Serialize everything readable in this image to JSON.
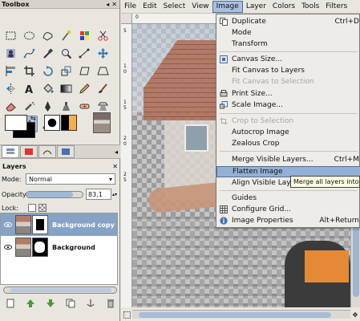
{
  "toolbox": {
    "title": "Toolbox",
    "window_controls": [
      "◂",
      "✕"
    ],
    "tools": [
      {
        "name": "rect-select-icon",
        "active": false
      },
      {
        "name": "ellipse-select-icon",
        "active": false
      },
      {
        "name": "free-select-icon",
        "active": false
      },
      {
        "name": "fuzzy-select-icon",
        "active": false
      },
      {
        "name": "color-select-icon",
        "active": false
      },
      {
        "name": "scissors-select-icon",
        "active": false
      },
      {
        "name": "foreground-select-icon",
        "active": false
      },
      {
        "name": "paths-icon",
        "active": false
      },
      {
        "name": "color-picker-icon",
        "active": false
      },
      {
        "name": "zoom-icon",
        "active": false
      },
      {
        "name": "measure-icon",
        "active": false
      },
      {
        "name": "move-icon",
        "active": false
      },
      {
        "name": "align-icon",
        "active": false
      },
      {
        "name": "crop-icon",
        "active": false
      },
      {
        "name": "rotate-icon",
        "active": false
      },
      {
        "name": "scale-icon",
        "active": false
      },
      {
        "name": "shear-icon",
        "active": false
      },
      {
        "name": "perspective-icon",
        "active": false
      },
      {
        "name": "flip-icon",
        "active": false
      },
      {
        "name": "text-icon",
        "active": false
      },
      {
        "name": "bucket-fill-icon",
        "active": false
      },
      {
        "name": "blend-icon",
        "active": false
      },
      {
        "name": "pencil-icon",
        "active": false
      },
      {
        "name": "paintbrush-icon",
        "active": false
      },
      {
        "name": "eraser-icon",
        "active": false
      },
      {
        "name": "airbrush-icon",
        "active": false
      },
      {
        "name": "ink-icon",
        "active": false
      },
      {
        "name": "clone-icon",
        "active": false
      },
      {
        "name": "heal-icon",
        "active": false
      },
      {
        "name": "perspective-clone-icon",
        "active": false
      },
      {
        "name": "blur-icon",
        "active": false
      },
      {
        "name": "smudge-icon",
        "active": true
      },
      {
        "name": "dodge-burn-icon",
        "active": false
      }
    ],
    "fg_color": "#ffffff",
    "bg_color": "#000000"
  },
  "layers": {
    "title": "Layers",
    "mode_label": "Mode:",
    "mode_value": "Normal",
    "opacity_label": "Opacity:",
    "opacity_value": "83,1",
    "opacity_fraction": 0.831,
    "lock_label": "Lock:",
    "items": [
      {
        "name": "Background copy",
        "selected": true
      },
      {
        "name": "Background",
        "selected": false
      }
    ]
  },
  "image_window": {
    "menus": [
      "File",
      "Edit",
      "Select",
      "View",
      "Image",
      "Layer",
      "Colors",
      "Tools",
      "Filters"
    ],
    "open_menu_index": 4,
    "ruler_left_numbers": [
      "5",
      "1",
      "0",
      "1",
      "5",
      "2",
      "0",
      "2",
      "5"
    ],
    "ruler_top_numbers": [
      "0"
    ]
  },
  "image_menu": {
    "items": [
      {
        "label": "Duplicate",
        "accel": "Ctrl+D",
        "icon": "duplicate-icon",
        "disabled": false
      },
      {
        "label": "Mode",
        "accel": "",
        "icon": "",
        "disabled": false
      },
      {
        "label": "Transform",
        "accel": "",
        "icon": "",
        "disabled": false
      },
      {
        "label": "Canvas Size...",
        "accel": "",
        "icon": "canvas-size-icon",
        "disabled": false
      },
      {
        "label": "Fit Canvas to Layers",
        "accel": "",
        "icon": "",
        "disabled": false
      },
      {
        "label": "Fit Canvas to Selection",
        "accel": "",
        "icon": "",
        "disabled": true
      },
      {
        "label": "Print Size...",
        "accel": "",
        "icon": "print-size-icon",
        "disabled": false
      },
      {
        "label": "Scale Image...",
        "accel": "",
        "icon": "scale-image-icon",
        "disabled": false
      },
      {
        "label": "Crop to Selection",
        "accel": "",
        "icon": "crop-selection-icon",
        "disabled": true
      },
      {
        "label": "Autocrop Image",
        "accel": "",
        "icon": "",
        "disabled": false
      },
      {
        "label": "Zealous Crop",
        "accel": "",
        "icon": "",
        "disabled": false
      },
      {
        "label": "Merge Visible Layers...",
        "accel": "Ctrl+M",
        "icon": "",
        "disabled": false
      },
      {
        "label": "Flatten Image",
        "accel": "",
        "icon": "",
        "disabled": false,
        "highlighted": true
      },
      {
        "label": "Align Visible Layers...",
        "accel": "",
        "icon": "",
        "disabled": false
      },
      {
        "label": "Guides",
        "accel": "",
        "icon": "",
        "disabled": false
      },
      {
        "label": "Configure Grid...",
        "accel": "",
        "icon": "grid-icon",
        "disabled": false
      },
      {
        "label": "Image Properties",
        "accel": "Alt+Return",
        "icon": "info-icon",
        "disabled": false
      }
    ]
  },
  "tooltip": {
    "text": "Merge all layers into one and remove transparency"
  }
}
